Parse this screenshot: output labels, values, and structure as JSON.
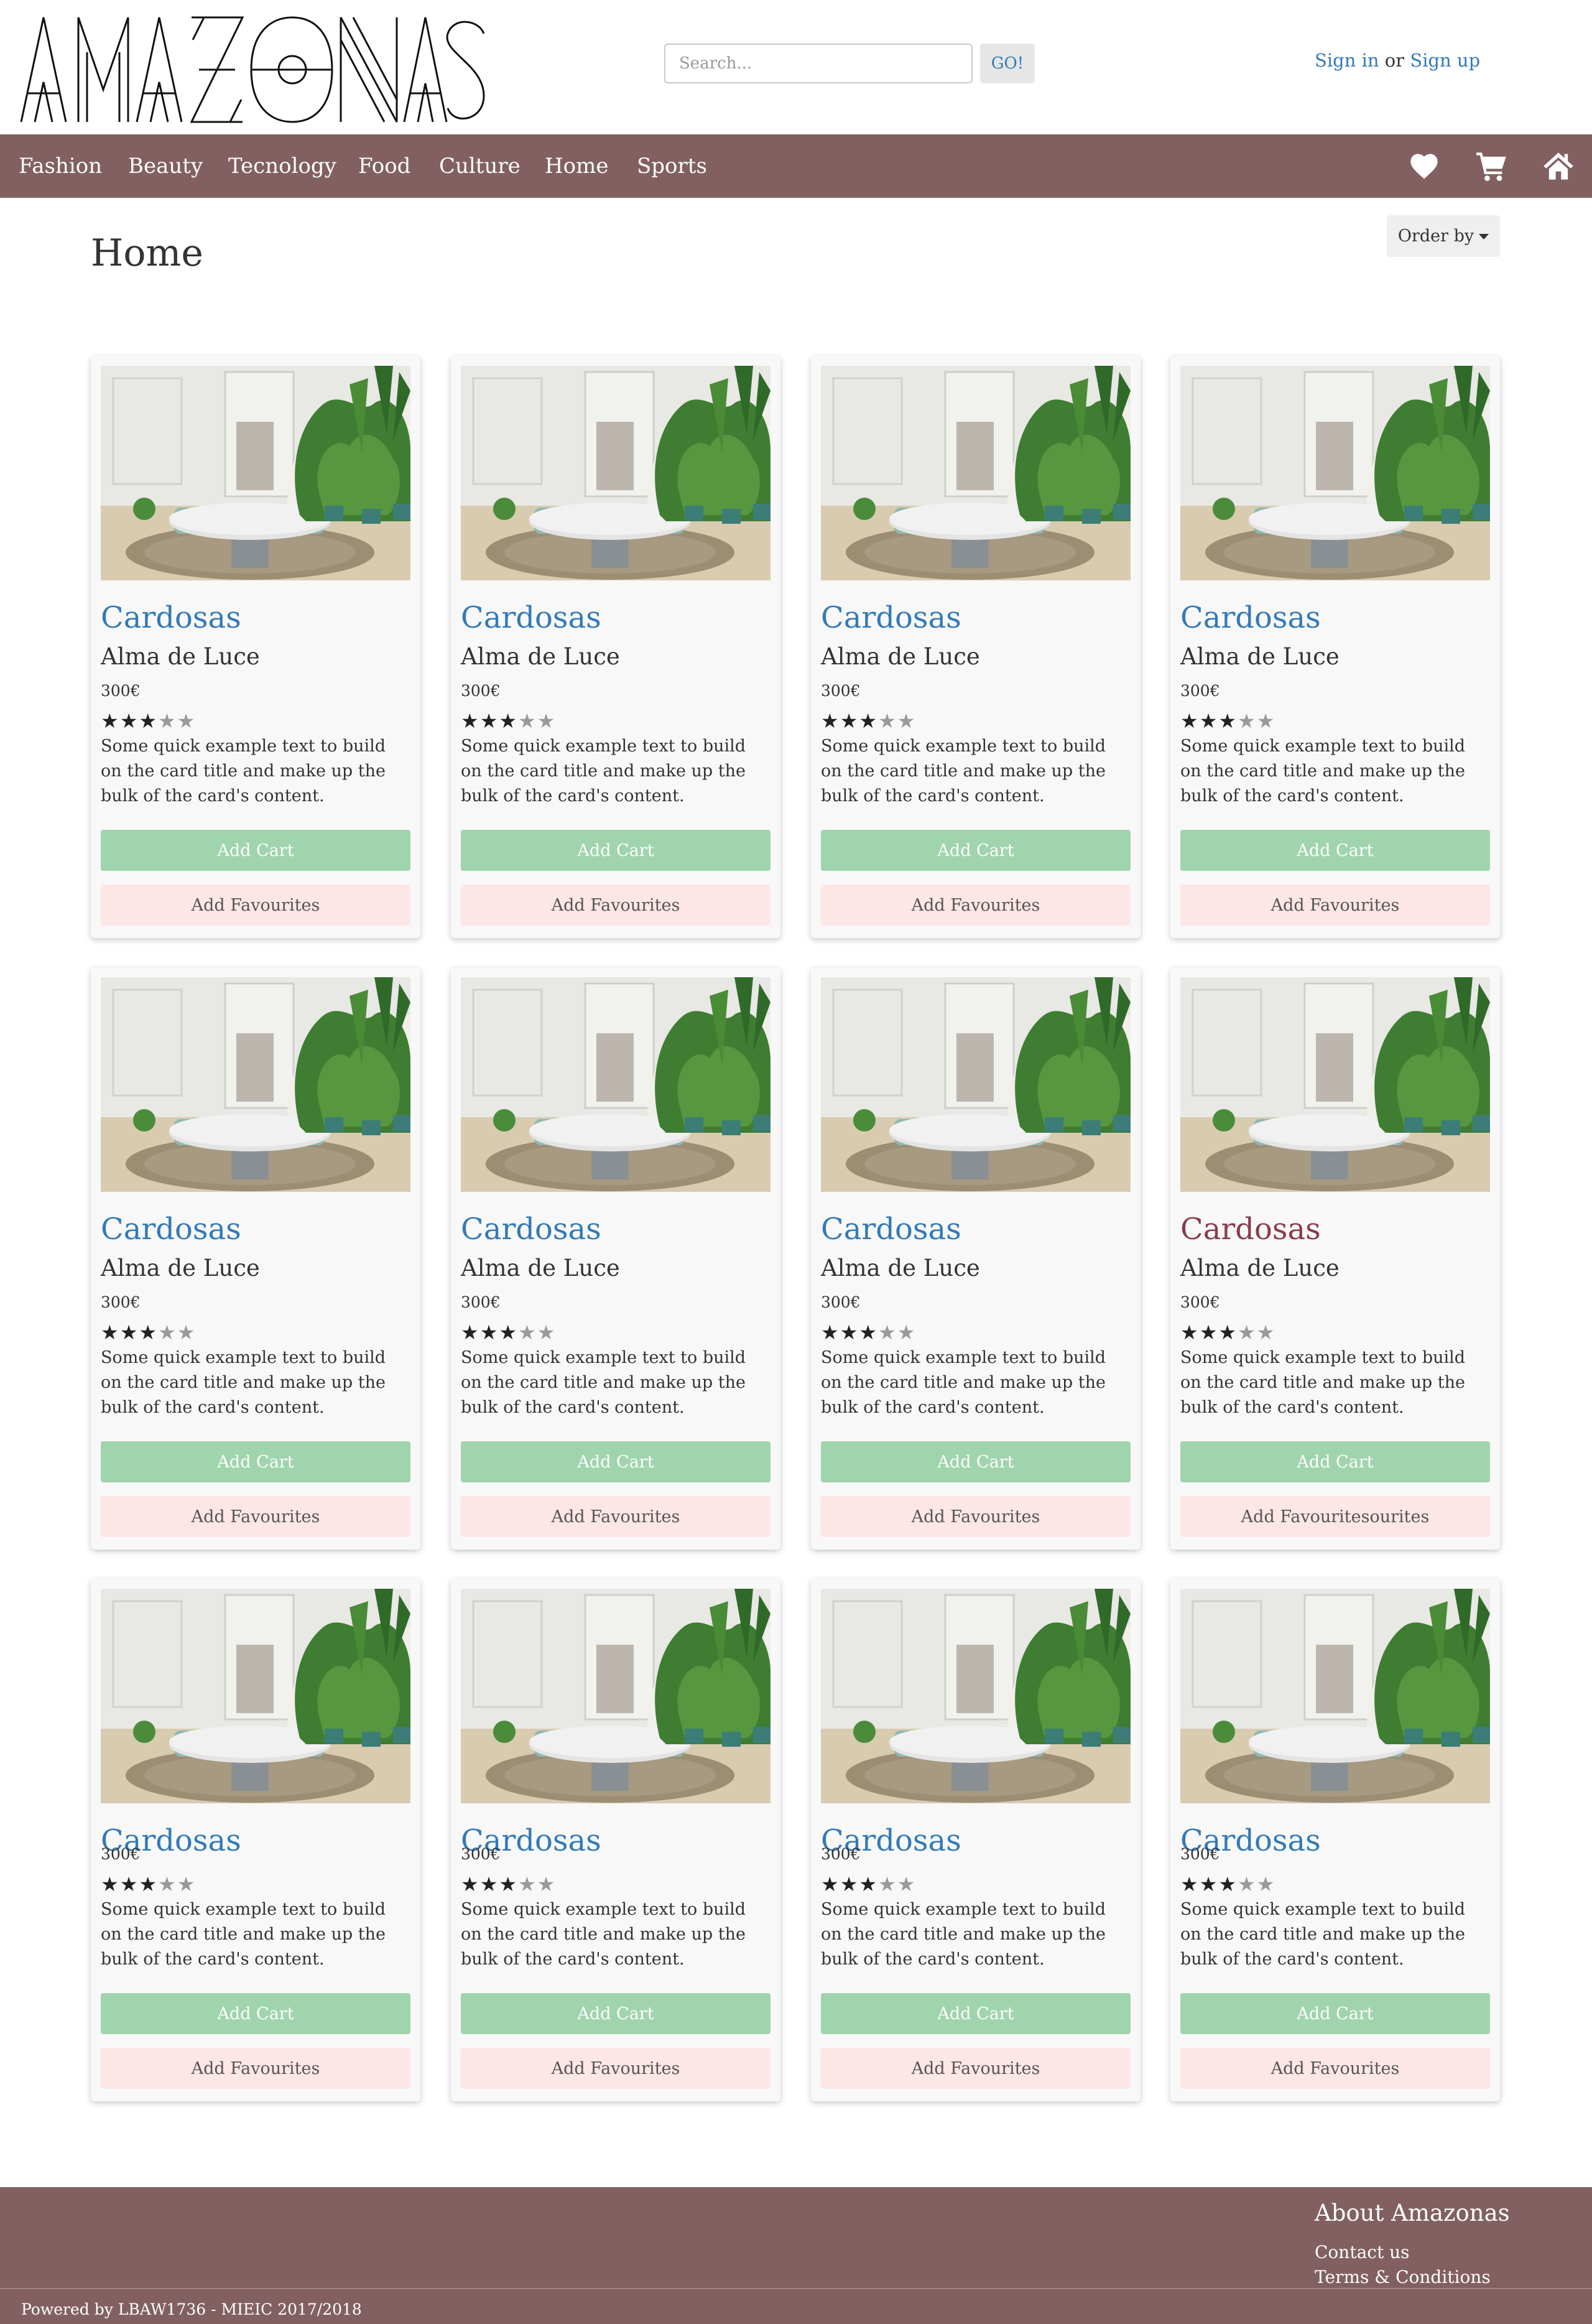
{
  "brand": {
    "logo_text": "AMAZONAS"
  },
  "search": {
    "placeholder": "Search...",
    "go_label": "GO!"
  },
  "auth": {
    "sign_in": "Sign in",
    "separator": "or",
    "sign_up": "Sign up"
  },
  "nav": {
    "items": [
      {
        "label": "Fashion"
      },
      {
        "label": "Beauty"
      },
      {
        "label": "Tecnology"
      },
      {
        "label": "Food"
      },
      {
        "label": "Culture"
      },
      {
        "label": "Home"
      },
      {
        "label": "Sports"
      }
    ],
    "icons": [
      "heart-icon",
      "cart-icon",
      "home-icon"
    ]
  },
  "page": {
    "title": "Home",
    "order_label": "Order by"
  },
  "colors": {
    "brand": "#826062",
    "link": "#337ab7",
    "link_hover": "#8a3b4f",
    "cart_button": "#a0d4ad",
    "fav_button": "#fde6e6"
  },
  "products": [
    {
      "title": "Cardosas",
      "subtitle": "Alma de Luce",
      "price": "300€",
      "rating": 3,
      "max_rating": 5,
      "text": "Some quick example text to build on the card title and make up the bulk of the card's content.",
      "cart_label": "Add Cart",
      "fav_label": "Add Favourites"
    },
    {
      "title": "Cardosas",
      "subtitle": "Alma de Luce",
      "price": "300€",
      "rating": 3,
      "max_rating": 5,
      "text": "Some quick example text to build on the card title and make up the bulk of the card's content.",
      "cart_label": "Add Cart",
      "fav_label": "Add Favourites"
    },
    {
      "title": "Cardosas",
      "subtitle": "Alma de Luce",
      "price": "300€",
      "rating": 3,
      "max_rating": 5,
      "text": "Some quick example text to build on the card title and make up the bulk of the card's content.",
      "cart_label": "Add Cart",
      "fav_label": "Add Favourites"
    },
    {
      "title": "Cardosas",
      "subtitle": "Alma de Luce",
      "price": "300€",
      "rating": 3,
      "max_rating": 5,
      "text": "Some quick example text to build on the card title and make up the bulk of the card's content.",
      "cart_label": "Add Cart",
      "fav_label": "Add Favourites"
    },
    {
      "title": "Cardosas",
      "subtitle": "Alma de Luce",
      "price": "300€",
      "rating": 3,
      "max_rating": 5,
      "text": "Some quick example text to build on the card title and make up the bulk of the card's content.",
      "cart_label": "Add Cart",
      "fav_label": "Add Favourites"
    },
    {
      "title": "Cardosas",
      "subtitle": "Alma de Luce",
      "price": "300€",
      "rating": 3,
      "max_rating": 5,
      "text": "Some quick example text to build on the card title and make up the bulk of the card's content.",
      "cart_label": "Add Cart",
      "fav_label": "Add Favourites"
    },
    {
      "title": "Cardosas",
      "subtitle": "Alma de Luce",
      "price": "300€",
      "rating": 3,
      "max_rating": 5,
      "text": "Some quick example text to build on the card title and make up the bulk of the card's content.",
      "cart_label": "Add Cart",
      "fav_label": "Add Favourites"
    },
    {
      "title": "Cardosas",
      "subtitle": "Alma de Luce",
      "price": "300€",
      "rating": 3,
      "max_rating": 5,
      "text": "Some quick example text to build on the card title and make up the bulk of the card's content.",
      "cart_label": "Add Cart",
      "fav_label": "Add Favouritesourites",
      "title_hovered": true
    },
    {
      "title": "Cardosas",
      "subtitle": "",
      "price": "300€",
      "rating": 3,
      "max_rating": 5,
      "text": "Some quick example text to build on the card title and make up the bulk of the card's content.",
      "cart_label": "Add Cart",
      "fav_label": "Add Favourites"
    },
    {
      "title": "Cardosas",
      "subtitle": "",
      "price": "300€",
      "rating": 3,
      "max_rating": 5,
      "text": "Some quick example text to build on the card title and make up the bulk of the card's content.",
      "cart_label": "Add Cart",
      "fav_label": "Add Favourites"
    },
    {
      "title": "Cardosas",
      "subtitle": "",
      "price": "300€",
      "rating": 3,
      "max_rating": 5,
      "text": "Some quick example text to build on the card title and make up the bulk of the card's content.",
      "cart_label": "Add Cart",
      "fav_label": "Add Favourites"
    },
    {
      "title": "Cardosas",
      "subtitle": "",
      "price": "300€",
      "rating": 3,
      "max_rating": 5,
      "text": "Some quick example text to build on the card title and make up the bulk of the card's content.",
      "cart_label": "Add Cart",
      "fav_label": "Add Favourites"
    }
  ],
  "footer": {
    "heading": "About Amazonas",
    "links": [
      {
        "label": "Contact us"
      },
      {
        "label": "Terms & Conditions"
      }
    ],
    "copyright": "Powered by LBAW1736 - MIEIC 2017/2018"
  }
}
